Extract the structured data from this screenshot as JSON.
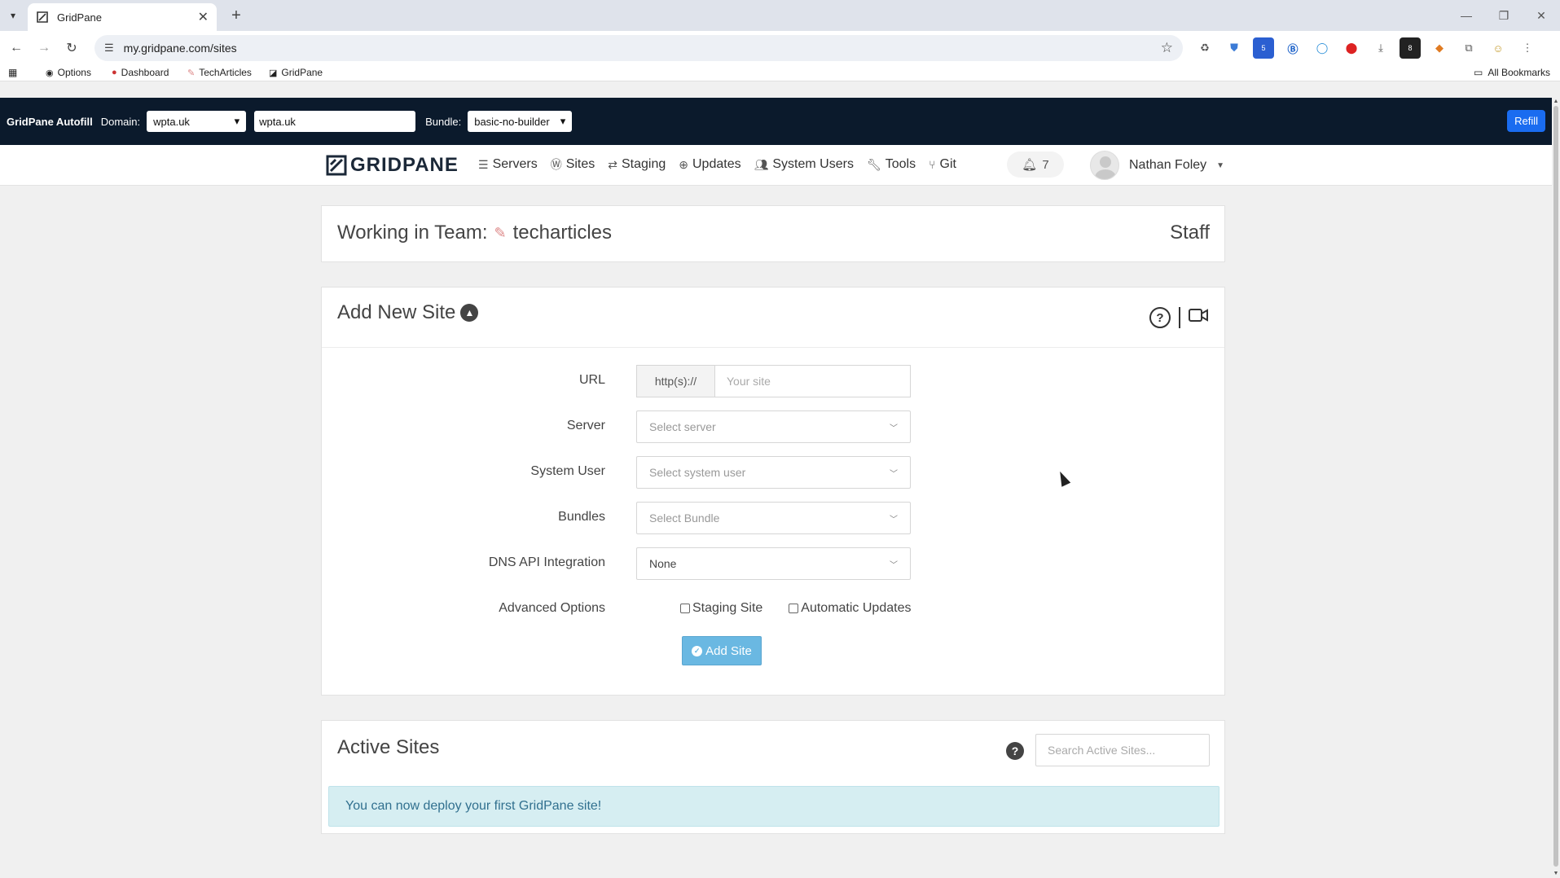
{
  "browser": {
    "tab_title": "GridPane",
    "url": "my.gridpane.com/sites",
    "bookmarks": [
      "Options",
      "Dashboard",
      "TechArticles",
      "GridPane"
    ],
    "all_bookmarks": "All Bookmarks",
    "extension_badges": {
      "ext3": "5",
      "ext10": "8"
    }
  },
  "autofill": {
    "title": "GridPane Autofill",
    "domain_label": "Domain:",
    "domain_value": "wpta.uk",
    "domain_text": "wpta.uk",
    "bundle_label": "Bundle:",
    "bundle_value": "basic-no-builder",
    "refill": "Refill"
  },
  "nav": {
    "logo": "GRIDPANE",
    "links": [
      "Servers",
      "Sites",
      "Staging",
      "Updates",
      "System Users",
      "Tools",
      "Git"
    ],
    "notifications": "7",
    "user": "Nathan Foley"
  },
  "team": {
    "label": "Working in Team:",
    "name": "techarticles",
    "role": "Staff"
  },
  "add_site": {
    "title": "Add New Site",
    "url_label": "URL",
    "url_prefix": "http(s)://",
    "url_placeholder": "Your site",
    "server_label": "Server",
    "server_placeholder": "Select server",
    "system_user_label": "System User",
    "system_user_placeholder": "Select system user",
    "bundles_label": "Bundles",
    "bundles_placeholder": "Select Bundle",
    "dns_label": "DNS API Integration",
    "dns_value": "None",
    "advanced_label": "Advanced Options",
    "staging_site": "Staging Site",
    "automatic_updates": "Automatic Updates",
    "add_button": "Add Site"
  },
  "active_sites": {
    "title": "Active Sites",
    "search_placeholder": "Search Active Sites...",
    "notice": "You can now deploy your first GridPane site!"
  }
}
